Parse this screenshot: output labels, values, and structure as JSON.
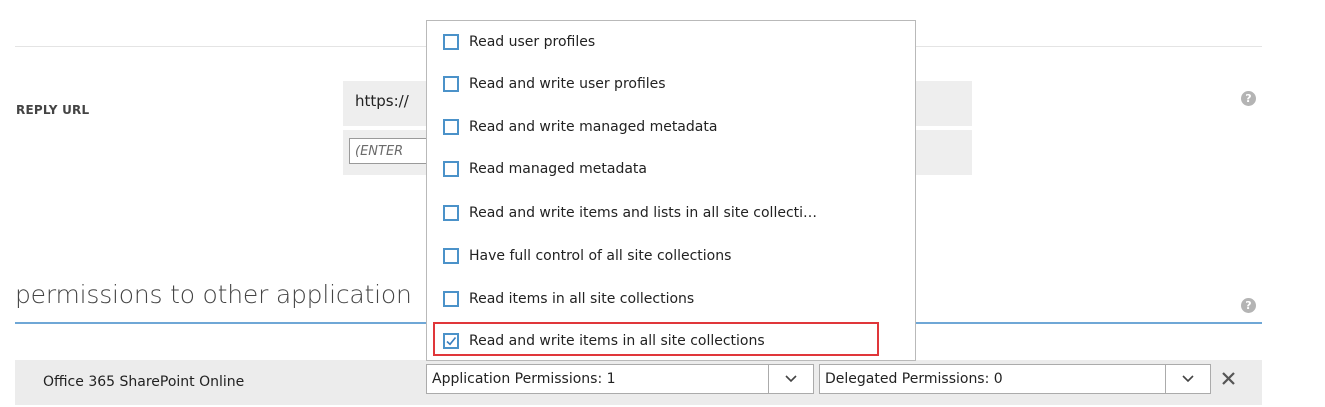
{
  "reply_url": {
    "label": "REPLY URL",
    "value": "https://",
    "input_placeholder": "(ENTER"
  },
  "permissions": {
    "section_title": "permissions to other application",
    "app_name": "Office 365 SharePoint Online",
    "application_dropdown": "Application Permissions: 1",
    "delegated_dropdown": "Delegated Permissions: 0"
  },
  "popup": {
    "options": [
      {
        "label": "Read user profiles",
        "checked": false
      },
      {
        "label": "Read and write user profiles",
        "checked": false
      },
      {
        "label": "Read and write managed metadata",
        "checked": false
      },
      {
        "label": "Read managed metadata",
        "checked": false
      },
      {
        "label": "Read and write items and lists in all site collecti…",
        "checked": false
      },
      {
        "label": "Have full control of all site collections",
        "checked": false
      },
      {
        "label": "Read items in all site collections",
        "checked": false
      },
      {
        "label": "Read and write items in all site collections",
        "checked": true
      }
    ]
  },
  "icons": {
    "help": "question-mark-icon",
    "dropdown": "chevron-down-icon",
    "remove": "close-icon",
    "checkbox_checked": "checkmark-icon"
  },
  "colors": {
    "accent": "#4b92c9",
    "highlight": "#e0363a",
    "section_line": "#6fa7d6"
  }
}
